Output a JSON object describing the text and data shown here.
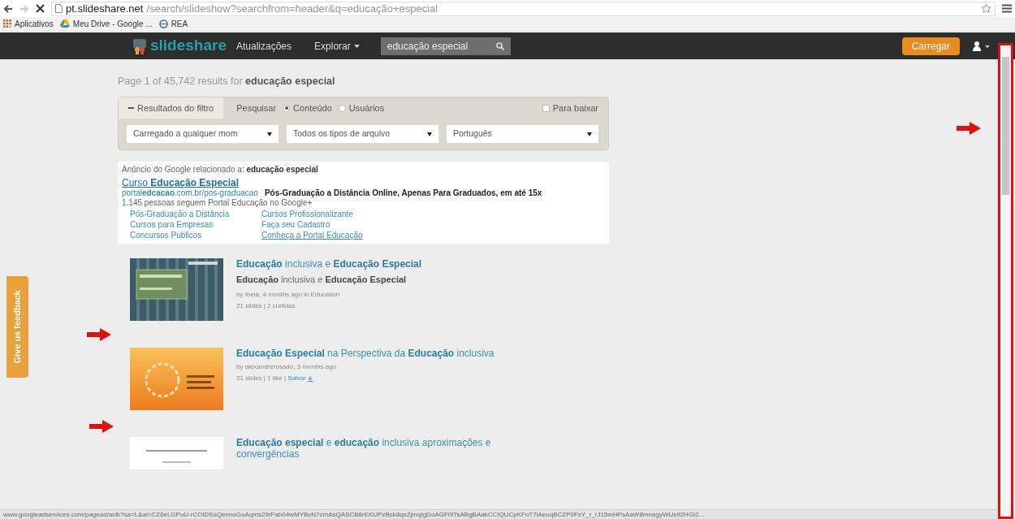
{
  "browser": {
    "url_host": "pt.slideshare.net",
    "url_path": "/search/slideshow?searchfrom=header&q=educação+especial",
    "bookmarks": [
      "Aplicativos",
      "Meu Drive - Google ...",
      "REA"
    ],
    "status_url": "www.googleadservices.com/pagead/aclk?sa=L&ai=CZ6eLGPuU-rCOlDSoQennoGoAqms29rFab04wMYBvN7cmAsQASCB8rEKUPzBsk8qsZjmqIgDoAGF0tTsABgBAakCCIQUCpKFnT7lAeuqBCZP0FsY_r_rJ15mHPsAaW8mnagyWUs92HGl2..."
  },
  "header": {
    "logo": "slideshare",
    "nav": [
      "Atualizações",
      "Explorar"
    ],
    "search_value": "educação especial",
    "upload_button": "Carregar"
  },
  "results_summary": "Page 1 of 45,742 results for **educação especial**",
  "filter": {
    "toggle": "Resultados do filtro",
    "search_label": "Pesquisar",
    "options": [
      {
        "label": "Conteúdo",
        "selected": true
      },
      {
        "label": "Usuários",
        "selected": false
      }
    ],
    "download": {
      "label": "Para baixar",
      "checked": false
    },
    "dropdowns": [
      "Carregado a qualquer mom",
      "Todos os tipos de arquivo",
      "Português"
    ]
  },
  "ad": {
    "heading": "Anúncio do Google relacionado a: **educação especial**",
    "title": "Curso **Educação Especial**",
    "url": "portal**edcacao**.com.br/pos-graduacao",
    "description": "Pós-Graduação a Distância Online, Apenas Para Graduados, em até 15x",
    "followers": "1.145 pessoas seguem Portal Educação no Google+",
    "links": [
      "Pós-Graduação a Distância",
      "Cursos Profissionalizante",
      "Cursos para Empresas",
      "Faça seu Cadastro",
      "Concursos Publicos",
      "Conheça a Portal Educação"
    ]
  },
  "feedback_tab": "Give us feedback",
  "results": [
    {
      "title": "**Educação** inclusiva e **Educação Especial**",
      "subtitle": "**Educação** inclusiva e **Educação Especial**",
      "byline": "by Ibela, 4 months ago in Education",
      "stats": "21 slides | 2 curtidas",
      "kind": "teal"
    },
    {
      "title": "**Educação Especial** na Perspectiva da **Educação** inclusiva",
      "byline": "by alexandrerosado, 3 months ago",
      "stats": "21 slides | 1 like | ",
      "save": "Salvar",
      "kind": "orange"
    },
    {
      "title": "**Educação especial** e **educação** inclusiva aproximações e convergências",
      "kind": "white"
    }
  ]
}
